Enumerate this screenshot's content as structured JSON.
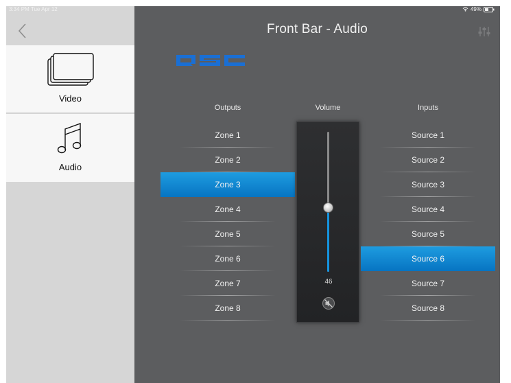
{
  "status_bar": {
    "time": "3:34 PM  Tue Apr 12",
    "battery": "49%"
  },
  "header": {
    "title": "Front Bar - Audio"
  },
  "brand": {
    "logo_text": "QSC",
    "color": "#1a6fd4"
  },
  "sidebar": {
    "items": [
      {
        "label": "Video",
        "icon": "video-stack-icon"
      },
      {
        "label": "Audio",
        "icon": "music-note-icon"
      }
    ]
  },
  "outputs": {
    "heading": "Outputs",
    "selected": "Zone 3",
    "items": [
      "Zone 1",
      "Zone 2",
      "Zone 3",
      "Zone 4",
      "Zone 5",
      "Zone 6",
      "Zone 7",
      "Zone 8"
    ]
  },
  "volume": {
    "heading": "Volume",
    "level": 46,
    "level_fraction": 0.46,
    "accent": "#1593de"
  },
  "inputs": {
    "heading": "Inputs",
    "selected": "Source 6",
    "items": [
      "Source 1",
      "Source 2",
      "Source 3",
      "Source 4",
      "Source 5",
      "Source 6",
      "Source 7",
      "Source 8"
    ]
  },
  "colors": {
    "background": "#5c5d5f",
    "sidebar": "#d6d6d6",
    "selection": "#0e88d2"
  }
}
